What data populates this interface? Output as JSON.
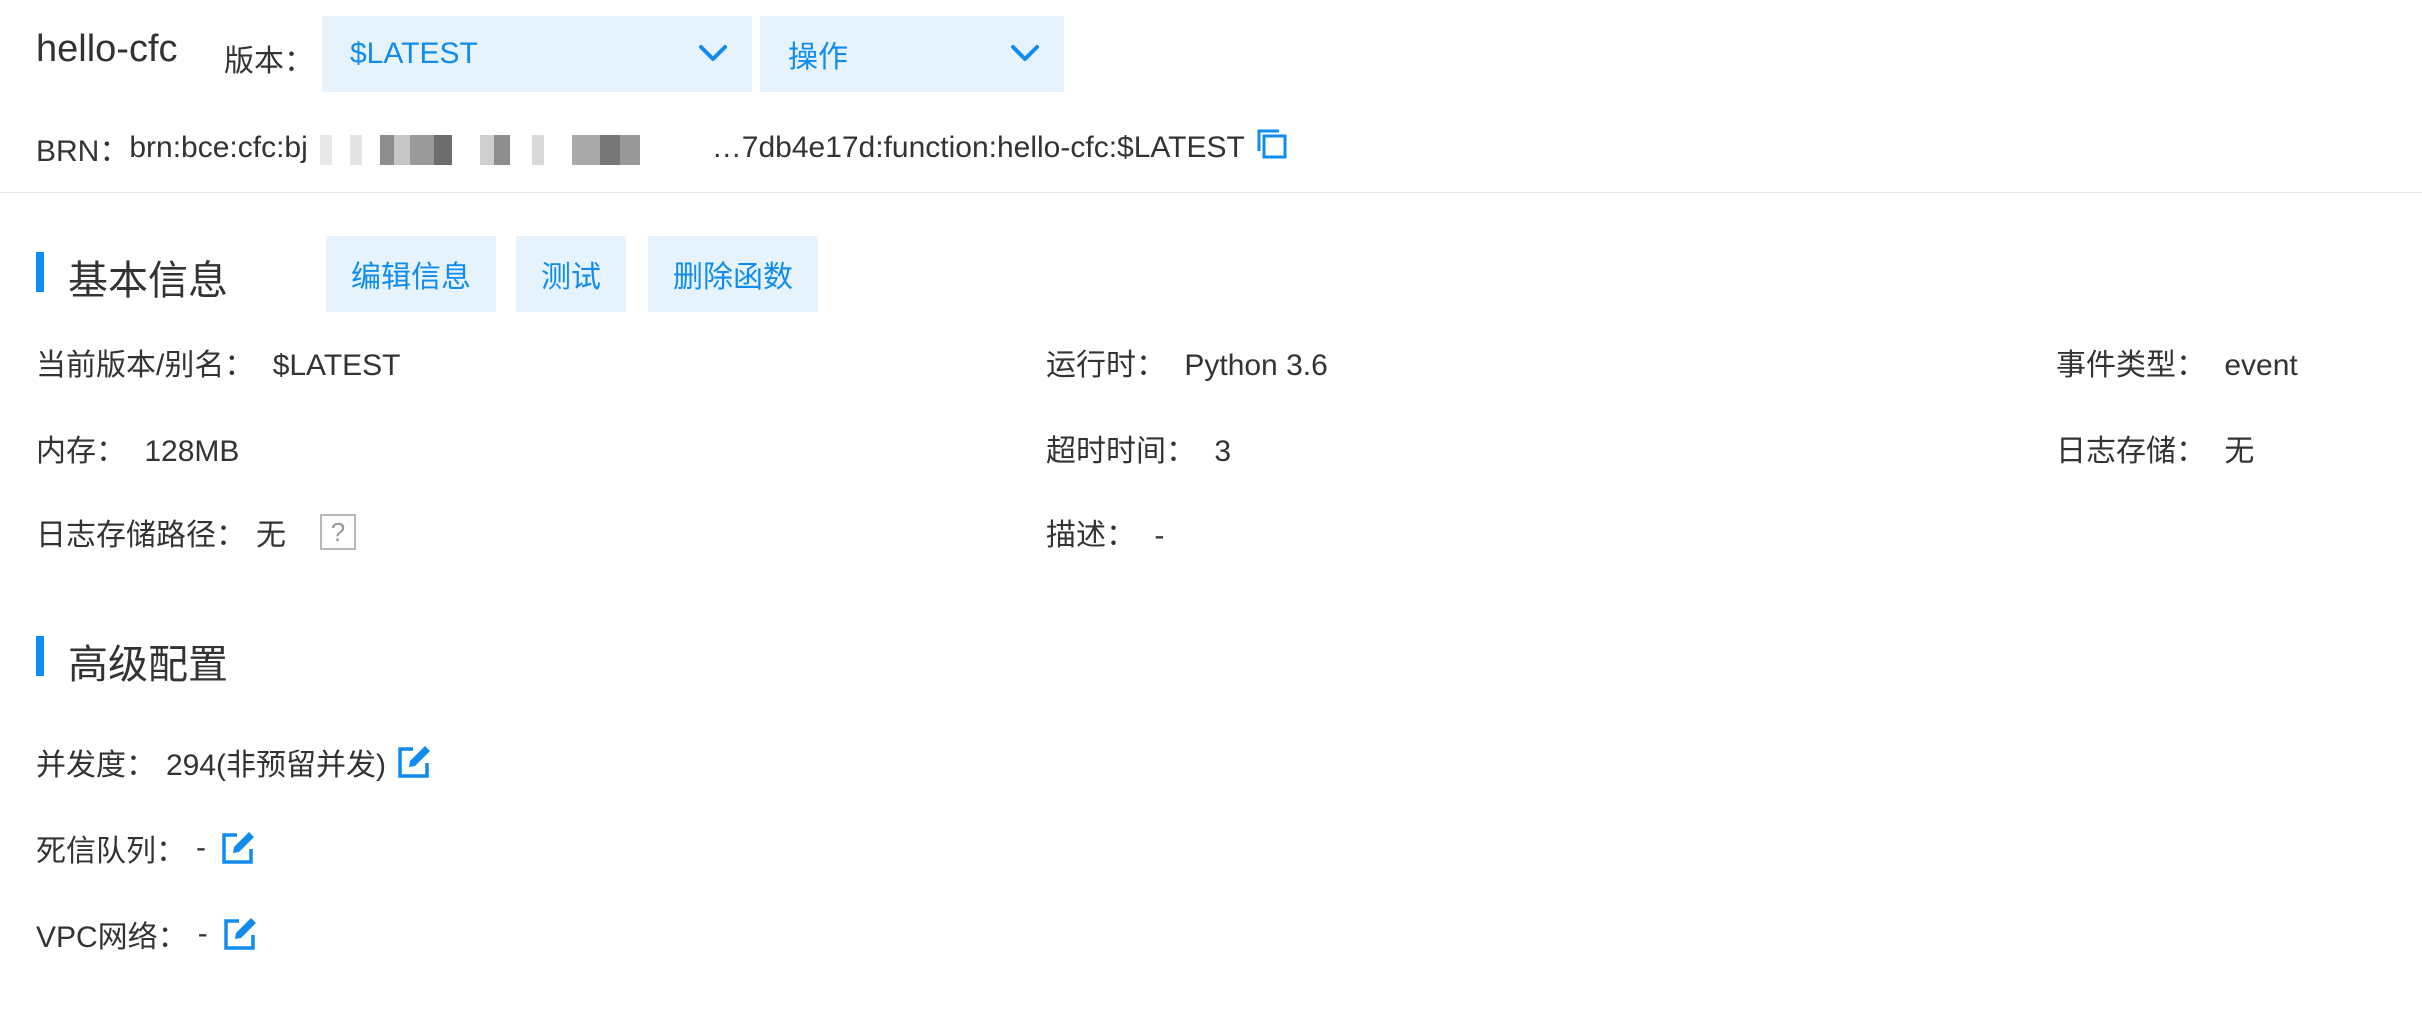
{
  "header": {
    "function_name": "hello-cfc",
    "version_label": "版本：",
    "version_selected": "$LATEST",
    "operations_label": "操作",
    "brn_label": "BRN：",
    "brn_prefix": "brn:bce:cfc:bj",
    "brn_suffix": "…7db4e17d:function:hello-cfc:$LATEST"
  },
  "basic_info": {
    "title": "基本信息",
    "buttons": {
      "edit": "编辑信息",
      "test": "测试",
      "delete": "删除函数"
    },
    "fields": {
      "current_version_label": "当前版本/别名：",
      "current_version_value": "$LATEST",
      "runtime_label": "运行时：",
      "runtime_value": "Python 3.6",
      "event_type_label": "事件类型：",
      "event_type_value": "event",
      "memory_label": "内存：",
      "memory_value": "128MB",
      "timeout_label": "超时时间：",
      "timeout_value": "3",
      "log_storage_label": "日志存储：",
      "log_storage_value": "无",
      "log_path_label": "日志存储路径：",
      "log_path_value": "无",
      "help_glyph": "?",
      "description_label": "描述：",
      "description_value": "-"
    }
  },
  "advanced_config": {
    "title": "高级配置",
    "concurrency_label": "并发度：",
    "concurrency_value": "294(非预留并发)",
    "dead_letter_label": "死信队列：",
    "dead_letter_value": "-",
    "vpc_label": "VPC网络：",
    "vpc_value": "-"
  },
  "colors": {
    "accent": "#108cee",
    "light_button_bg": "#e6f3fc",
    "text": "#333333"
  },
  "icons": {
    "dropdown": "chevron-down-icon",
    "copy": "copy-icon",
    "help": "question-icon",
    "edit": "edit-icon"
  }
}
